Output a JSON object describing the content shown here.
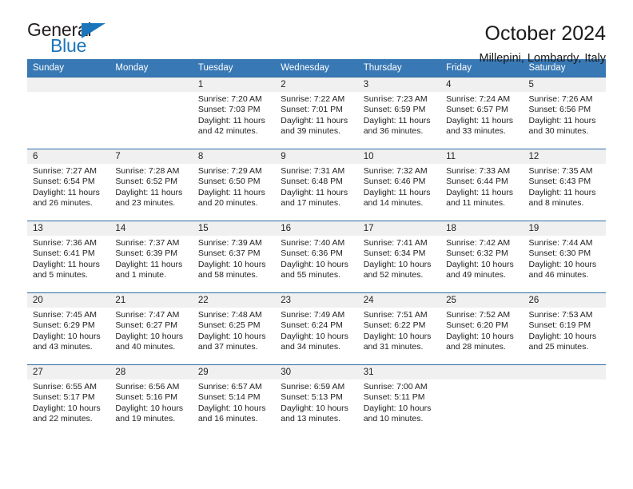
{
  "brand": {
    "name_part1": "General",
    "name_part2": "Blue",
    "triangle_color": "#1b75bb",
    "text_color": "#231f20"
  },
  "header": {
    "title": "October 2024",
    "subtitle": "Millepini, Lombardy, Italy"
  },
  "calendar": {
    "header_bg": "#3878b4",
    "header_text_color": "#ffffff",
    "daynum_bg": "#f0f0f0",
    "weekday_headers": [
      "Sunday",
      "Monday",
      "Tuesday",
      "Wednesday",
      "Thursday",
      "Friday",
      "Saturday"
    ],
    "weeks": [
      [
        {
          "day": "",
          "sunrise": "",
          "sunset": "",
          "daylight": ""
        },
        {
          "day": "",
          "sunrise": "",
          "sunset": "",
          "daylight": ""
        },
        {
          "day": "1",
          "sunrise": "Sunrise: 7:20 AM",
          "sunset": "Sunset: 7:03 PM",
          "daylight": "Daylight: 11 hours and 42 minutes."
        },
        {
          "day": "2",
          "sunrise": "Sunrise: 7:22 AM",
          "sunset": "Sunset: 7:01 PM",
          "daylight": "Daylight: 11 hours and 39 minutes."
        },
        {
          "day": "3",
          "sunrise": "Sunrise: 7:23 AM",
          "sunset": "Sunset: 6:59 PM",
          "daylight": "Daylight: 11 hours and 36 minutes."
        },
        {
          "day": "4",
          "sunrise": "Sunrise: 7:24 AM",
          "sunset": "Sunset: 6:57 PM",
          "daylight": "Daylight: 11 hours and 33 minutes."
        },
        {
          "day": "5",
          "sunrise": "Sunrise: 7:26 AM",
          "sunset": "Sunset: 6:56 PM",
          "daylight": "Daylight: 11 hours and 30 minutes."
        }
      ],
      [
        {
          "day": "6",
          "sunrise": "Sunrise: 7:27 AM",
          "sunset": "Sunset: 6:54 PM",
          "daylight": "Daylight: 11 hours and 26 minutes."
        },
        {
          "day": "7",
          "sunrise": "Sunrise: 7:28 AM",
          "sunset": "Sunset: 6:52 PM",
          "daylight": "Daylight: 11 hours and 23 minutes."
        },
        {
          "day": "8",
          "sunrise": "Sunrise: 7:29 AM",
          "sunset": "Sunset: 6:50 PM",
          "daylight": "Daylight: 11 hours and 20 minutes."
        },
        {
          "day": "9",
          "sunrise": "Sunrise: 7:31 AM",
          "sunset": "Sunset: 6:48 PM",
          "daylight": "Daylight: 11 hours and 17 minutes."
        },
        {
          "day": "10",
          "sunrise": "Sunrise: 7:32 AM",
          "sunset": "Sunset: 6:46 PM",
          "daylight": "Daylight: 11 hours and 14 minutes."
        },
        {
          "day": "11",
          "sunrise": "Sunrise: 7:33 AM",
          "sunset": "Sunset: 6:44 PM",
          "daylight": "Daylight: 11 hours and 11 minutes."
        },
        {
          "day": "12",
          "sunrise": "Sunrise: 7:35 AM",
          "sunset": "Sunset: 6:43 PM",
          "daylight": "Daylight: 11 hours and 8 minutes."
        }
      ],
      [
        {
          "day": "13",
          "sunrise": "Sunrise: 7:36 AM",
          "sunset": "Sunset: 6:41 PM",
          "daylight": "Daylight: 11 hours and 5 minutes."
        },
        {
          "day": "14",
          "sunrise": "Sunrise: 7:37 AM",
          "sunset": "Sunset: 6:39 PM",
          "daylight": "Daylight: 11 hours and 1 minute."
        },
        {
          "day": "15",
          "sunrise": "Sunrise: 7:39 AM",
          "sunset": "Sunset: 6:37 PM",
          "daylight": "Daylight: 10 hours and 58 minutes."
        },
        {
          "day": "16",
          "sunrise": "Sunrise: 7:40 AM",
          "sunset": "Sunset: 6:36 PM",
          "daylight": "Daylight: 10 hours and 55 minutes."
        },
        {
          "day": "17",
          "sunrise": "Sunrise: 7:41 AM",
          "sunset": "Sunset: 6:34 PM",
          "daylight": "Daylight: 10 hours and 52 minutes."
        },
        {
          "day": "18",
          "sunrise": "Sunrise: 7:42 AM",
          "sunset": "Sunset: 6:32 PM",
          "daylight": "Daylight: 10 hours and 49 minutes."
        },
        {
          "day": "19",
          "sunrise": "Sunrise: 7:44 AM",
          "sunset": "Sunset: 6:30 PM",
          "daylight": "Daylight: 10 hours and 46 minutes."
        }
      ],
      [
        {
          "day": "20",
          "sunrise": "Sunrise: 7:45 AM",
          "sunset": "Sunset: 6:29 PM",
          "daylight": "Daylight: 10 hours and 43 minutes."
        },
        {
          "day": "21",
          "sunrise": "Sunrise: 7:47 AM",
          "sunset": "Sunset: 6:27 PM",
          "daylight": "Daylight: 10 hours and 40 minutes."
        },
        {
          "day": "22",
          "sunrise": "Sunrise: 7:48 AM",
          "sunset": "Sunset: 6:25 PM",
          "daylight": "Daylight: 10 hours and 37 minutes."
        },
        {
          "day": "23",
          "sunrise": "Sunrise: 7:49 AM",
          "sunset": "Sunset: 6:24 PM",
          "daylight": "Daylight: 10 hours and 34 minutes."
        },
        {
          "day": "24",
          "sunrise": "Sunrise: 7:51 AM",
          "sunset": "Sunset: 6:22 PM",
          "daylight": "Daylight: 10 hours and 31 minutes."
        },
        {
          "day": "25",
          "sunrise": "Sunrise: 7:52 AM",
          "sunset": "Sunset: 6:20 PM",
          "daylight": "Daylight: 10 hours and 28 minutes."
        },
        {
          "day": "26",
          "sunrise": "Sunrise: 7:53 AM",
          "sunset": "Sunset: 6:19 PM",
          "daylight": "Daylight: 10 hours and 25 minutes."
        }
      ],
      [
        {
          "day": "27",
          "sunrise": "Sunrise: 6:55 AM",
          "sunset": "Sunset: 5:17 PM",
          "daylight": "Daylight: 10 hours and 22 minutes."
        },
        {
          "day": "28",
          "sunrise": "Sunrise: 6:56 AM",
          "sunset": "Sunset: 5:16 PM",
          "daylight": "Daylight: 10 hours and 19 minutes."
        },
        {
          "day": "29",
          "sunrise": "Sunrise: 6:57 AM",
          "sunset": "Sunset: 5:14 PM",
          "daylight": "Daylight: 10 hours and 16 minutes."
        },
        {
          "day": "30",
          "sunrise": "Sunrise: 6:59 AM",
          "sunset": "Sunset: 5:13 PM",
          "daylight": "Daylight: 10 hours and 13 minutes."
        },
        {
          "day": "31",
          "sunrise": "Sunrise: 7:00 AM",
          "sunset": "Sunset: 5:11 PM",
          "daylight": "Daylight: 10 hours and 10 minutes."
        },
        {
          "day": "",
          "sunrise": "",
          "sunset": "",
          "daylight": ""
        },
        {
          "day": "",
          "sunrise": "",
          "sunset": "",
          "daylight": ""
        }
      ]
    ]
  }
}
